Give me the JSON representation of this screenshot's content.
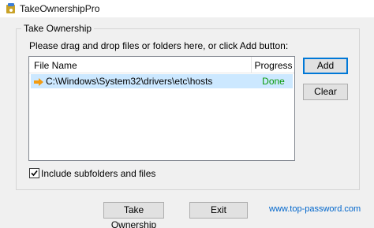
{
  "window": {
    "title": "TakeOwnershipPro",
    "icon": "takeownershippro-app-icon"
  },
  "group": {
    "label": "Take Ownership",
    "instructions": "Please drag and drop files or folders here, or click Add button:"
  },
  "list": {
    "columns": [
      "File Name",
      "Progress"
    ],
    "rows": [
      {
        "icon": "arrow-right-icon",
        "path": "C:\\Windows\\System32\\drivers\\etc\\hosts",
        "status": "Done",
        "selected": true
      }
    ]
  },
  "buttons": {
    "add": "Add",
    "clear": "Clear",
    "take_ownership": "Take Ownership",
    "exit": "Exit"
  },
  "options": {
    "include_subfolders_label": "Include subfolders and files",
    "include_subfolders_checked": true
  },
  "footer": {
    "link": "www.top-password.com"
  },
  "colors": {
    "accent": "#0078d7",
    "selection": "#cce8ff",
    "done": "#0a9a0a",
    "link": "#0066cc",
    "arrow": "#f39c12"
  }
}
